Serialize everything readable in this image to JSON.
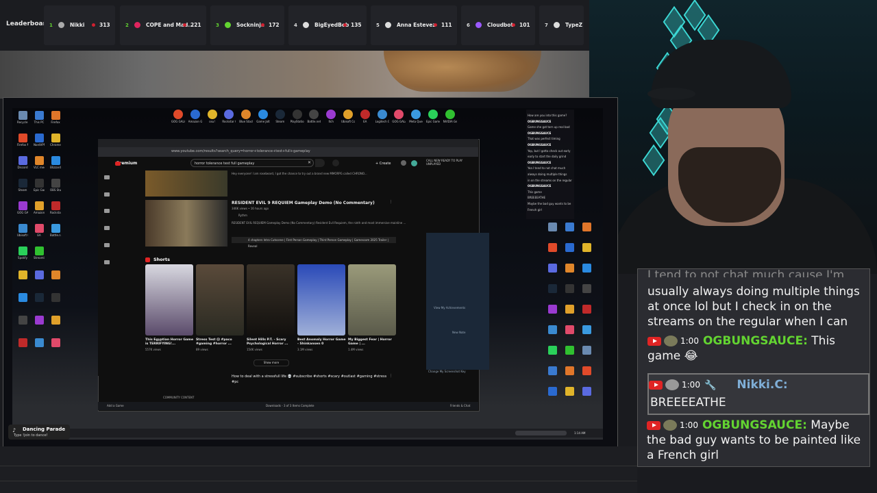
{
  "leaderboard": {
    "title": "Leaderboard",
    "entries": [
      {
        "rank": "1",
        "name": "Nikki",
        "score": "313",
        "color": "#aaaaaa"
      },
      {
        "rank": "2",
        "name": "COPE and Mad...",
        "score": "221",
        "color": "#e0245e"
      },
      {
        "rank": "3",
        "name": "Sockninja",
        "score": "172",
        "color": "#63d431"
      },
      {
        "rank": "4",
        "name": "BigEyedBob",
        "score": "135",
        "color": "#dddddd"
      },
      {
        "rank": "5",
        "name": "Anna Estevez",
        "score": "111",
        "color": "#dddddd"
      },
      {
        "rank": "6",
        "name": "Cloudbot",
        "score": "101",
        "color": "#9b59ff"
      },
      {
        "rank": "7",
        "name": "TypeZ",
        "score": "",
        "color": "#dddddd"
      }
    ]
  },
  "chat": {
    "partial_top": "I tend to not chat much cause I'm",
    "message_cont": "usually always doing multiple things at once lol but I check in on the streams on the regular when I can",
    "messages": [
      {
        "time": "1:00",
        "user": "OGBUNGSAUCE:",
        "text": "This game 😂"
      },
      {
        "time": "1:00",
        "user": "Nikki.C:",
        "text": "BREEEEATHE"
      },
      {
        "time": "1:00",
        "user": "OGBUNGSAUCE:",
        "text": "Maybe the bad guy wants to be painted like a French girl"
      }
    ]
  },
  "browser": {
    "url": "www.youtube.com/results?search_query=horror+tolerance+test+full+gameplay",
    "logo": "Premium",
    "search_value": "horror tolerance test full gameplay",
    "create_label": "+ Create",
    "video1_desc": "Hey everyone! I am rosebeard, I got the chance to try out a brand new MMORPG called CHRONO...",
    "video2": {
      "title": "RESIDENT EVIL 9 REQUIEM Gameplay Demo (No Commentary)",
      "meta": "346K views • 16 hours ago",
      "channel": "Rythm",
      "desc": "RESIDENT EVIL REQUIEM Gameplay Demo (No Commentary) Resident Evil Requiem, the ninth and most immersive mainline ...",
      "chapters": "4 chapters  Intro Cutscene | First Person Gameplay | Third Person Gameplay | Gamescom 2025 Trailer | Reveal"
    },
    "shorts_heading": "Shorts",
    "shorts": [
      {
        "title": "This Egyptian Horror Game is TERRIFYING!...",
        "views": "557K views",
        "color1": "#d8d8e0",
        "color2": "#5a4a6a"
      },
      {
        "title": "Stress Test 😱 #paco #gaming #horror ...",
        "views": "89 views",
        "color1": "#5a4a3a",
        "color2": "#2a2a22"
      },
      {
        "title": "Silent Hills P.T. - Scary Psychological Horror ...",
        "views": "154K views",
        "color1": "#3a3228",
        "color2": "#12100e"
      },
      {
        "title": "Best Anomaly Horror Game - Shinkansen 0",
        "views": "3.1M views",
        "color1": "#2a4ab8",
        "color2": "#a0b0d8"
      },
      {
        "title": "My Biggest Fear | Horror Game | ...",
        "views": "1.4M views",
        "color1": "#9a9a7a",
        "color2": "#5a5a4a"
      }
    ],
    "show_more": "Show more",
    "video3_title": "How to deal with a stressfull life 💀 #subscribe #shorts #scary #outlast #gaming #stress #pc",
    "community": "COMMUNITY CONTENT",
    "friends_left": "Add a Game",
    "friends_mid": "Downloads - 3 of 3 Items Complete",
    "friends_right": "Friends & Chat"
  },
  "steam_panel": {
    "tabs": "CALL  NEW  READY TO PLAY  UNPLAYED",
    "text1": "View My Achievements",
    "text2": "New Note",
    "text3": "Change My Screenshot Key"
  },
  "side_chat": {
    "lines": [
      "How are you into this game?",
      "OGBUNGSAUCE",
      "Game she got torn up real bad",
      "OGBUNGSAUCE",
      "That was perfect timing",
      "OGBUNGSAUCE",
      "Yep, but I gotta check out early",
      "early to start the daily grind",
      "OGBUNGSAUCE",
      "Yea I tend to not chat much",
      "always doing multiple things",
      "in on the streams on the regular",
      "OGBUNGSAUCE",
      "This game",
      "BREEEEATHE",
      "Maybe the bad guy wants to be",
      "French girl"
    ]
  },
  "taskbar": {
    "music_title": "Dancing Parade",
    "music_sub": "Type !join to dance!",
    "clock": "1:14 AM"
  },
  "desktop_icons": [
    "Recycle Bin",
    "This PC",
    "Firefox",
    "Firefox Nightmare",
    "NordVPN",
    "Chrome",
    "Discord",
    "VLC media player",
    "Blizzard",
    "Steam",
    "Epic Games",
    "OBS Studio",
    "GOG GALAXY",
    "Amazon Games",
    "Rockstar Games",
    "Ubisoft Connect",
    "EA",
    "Battle.net",
    "Spotify",
    "Streamlabs"
  ],
  "top_shortcuts": [
    "GOG GALAXY",
    "Amazon Games",
    "osu!",
    "Rockstar Games",
    "Blue Stacks",
    "Game Jolt",
    "Steam",
    "PlayStation",
    "Battle.net",
    "Itch",
    "Ubisoft Connect",
    "EA",
    "Logitech G HUB",
    "GOG GALAXY",
    "Meta Quest Link",
    "Epic Games Launcher",
    "NVIDIA GeForce"
  ]
}
